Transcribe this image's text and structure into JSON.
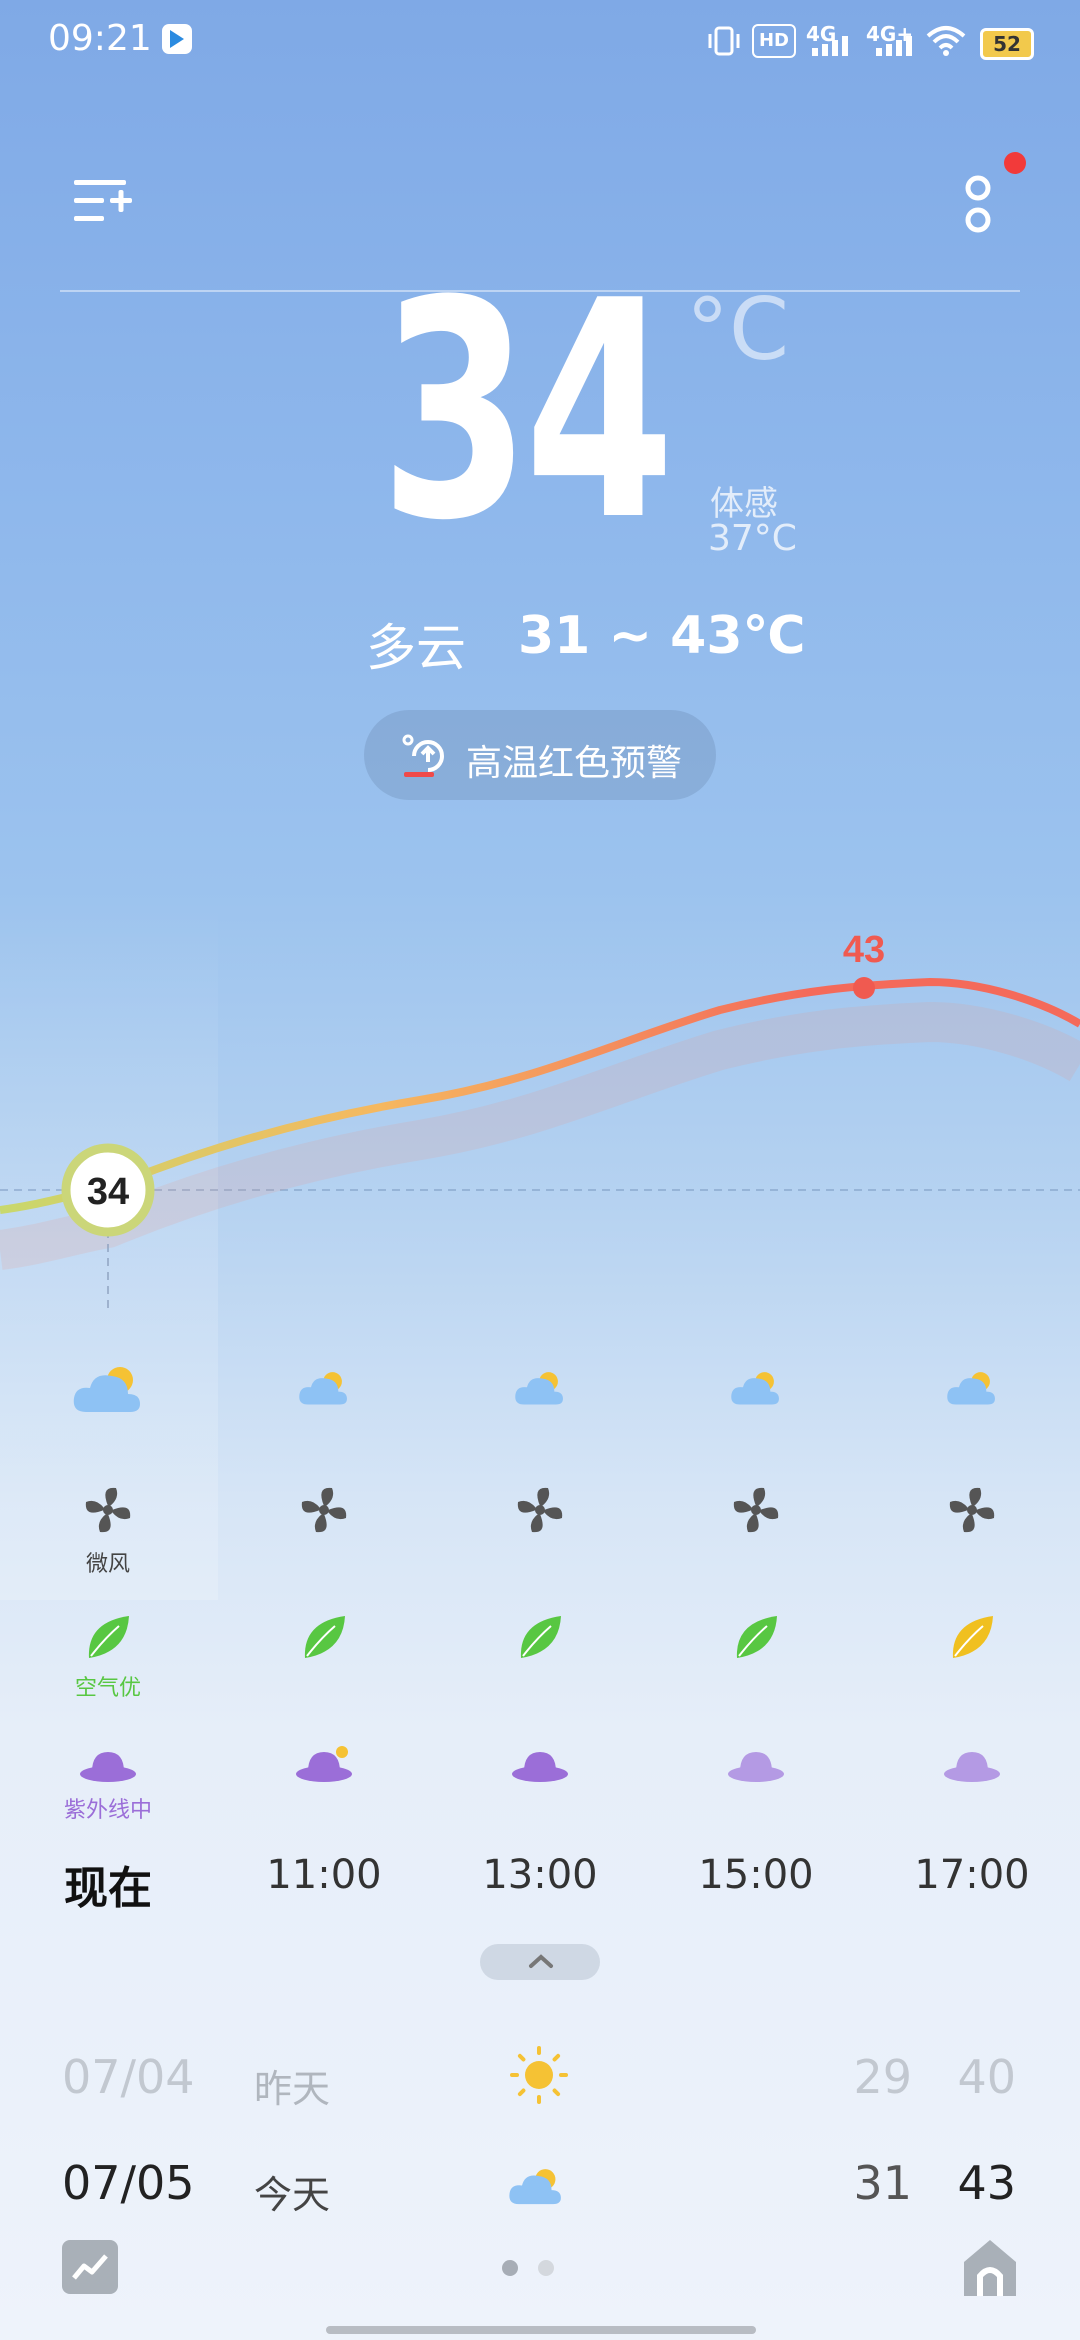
{
  "status_bar": {
    "time": "09:21",
    "signal_1": "4G",
    "signal_2": "4G+",
    "battery": "52",
    "hd_label": "HD"
  },
  "header": {
    "menu_icon": "add-city-menu-icon",
    "more_icon": "more-options-icon",
    "notification_dot_color": "#f23a3a"
  },
  "current": {
    "temperature": "34",
    "unit": "°C",
    "feels_like_label": "体感",
    "feels_like_value": "37°C",
    "condition": "多云",
    "range": "31 ~ 43℃"
  },
  "alert": {
    "text": "高温红色预警",
    "icon": "heat-warning-icon"
  },
  "hourly_chart": {
    "current_marker": "34",
    "peak_label": "43",
    "line_colors": [
      "#c8d86c",
      "#f5b860",
      "#f46a5a"
    ]
  },
  "hourly": [
    {
      "time": "现在",
      "weather_icon": "partly-cloudy-icon",
      "wind_icon": "wind-fan-icon",
      "wind_label": "微风",
      "air_icon": "leaf-icon",
      "air_label": "空气优",
      "air_color": "#58c742",
      "uv_icon": "sun-hat-icon",
      "uv_label": "紫外线中",
      "uv_color": "#9b6ed8"
    },
    {
      "time": "11:00",
      "weather_icon": "partly-cloudy-icon",
      "wind_icon": "wind-fan-icon",
      "air_icon": "leaf-icon",
      "air_color": "#58c742",
      "uv_icon": "sun-hat-icon",
      "uv_color": "#9b6ed8"
    },
    {
      "time": "13:00",
      "weather_icon": "partly-cloudy-icon",
      "wind_icon": "wind-fan-icon",
      "air_icon": "leaf-icon",
      "air_color": "#58c742",
      "uv_icon": "sun-hat-icon",
      "uv_color": "#9b6ed8"
    },
    {
      "time": "15:00",
      "weather_icon": "partly-cloudy-icon",
      "wind_icon": "wind-fan-icon",
      "air_icon": "leaf-icon",
      "air_color": "#58c742",
      "uv_icon": "sun-hat-icon",
      "uv_color": "#b49ae4"
    },
    {
      "time": "17:00",
      "weather_icon": "partly-cloudy-icon",
      "wind_icon": "wind-fan-icon",
      "air_icon": "leaf-icon",
      "air_color": "#f0c020",
      "uv_icon": "sun-hat-icon",
      "uv_color": "#b49ae4"
    }
  ],
  "daily": [
    {
      "date": "07/04",
      "day": "昨天",
      "icon": "sunny-icon",
      "low": "29",
      "high": "40"
    },
    {
      "date": "07/05",
      "day": "今天",
      "icon": "partly-cloudy-icon",
      "low": "31",
      "high": "43"
    }
  ],
  "bottom": {
    "trend_icon": "trend-chart-icon",
    "home_icon": "home-icon",
    "page_count": 2,
    "active_page": 1
  }
}
